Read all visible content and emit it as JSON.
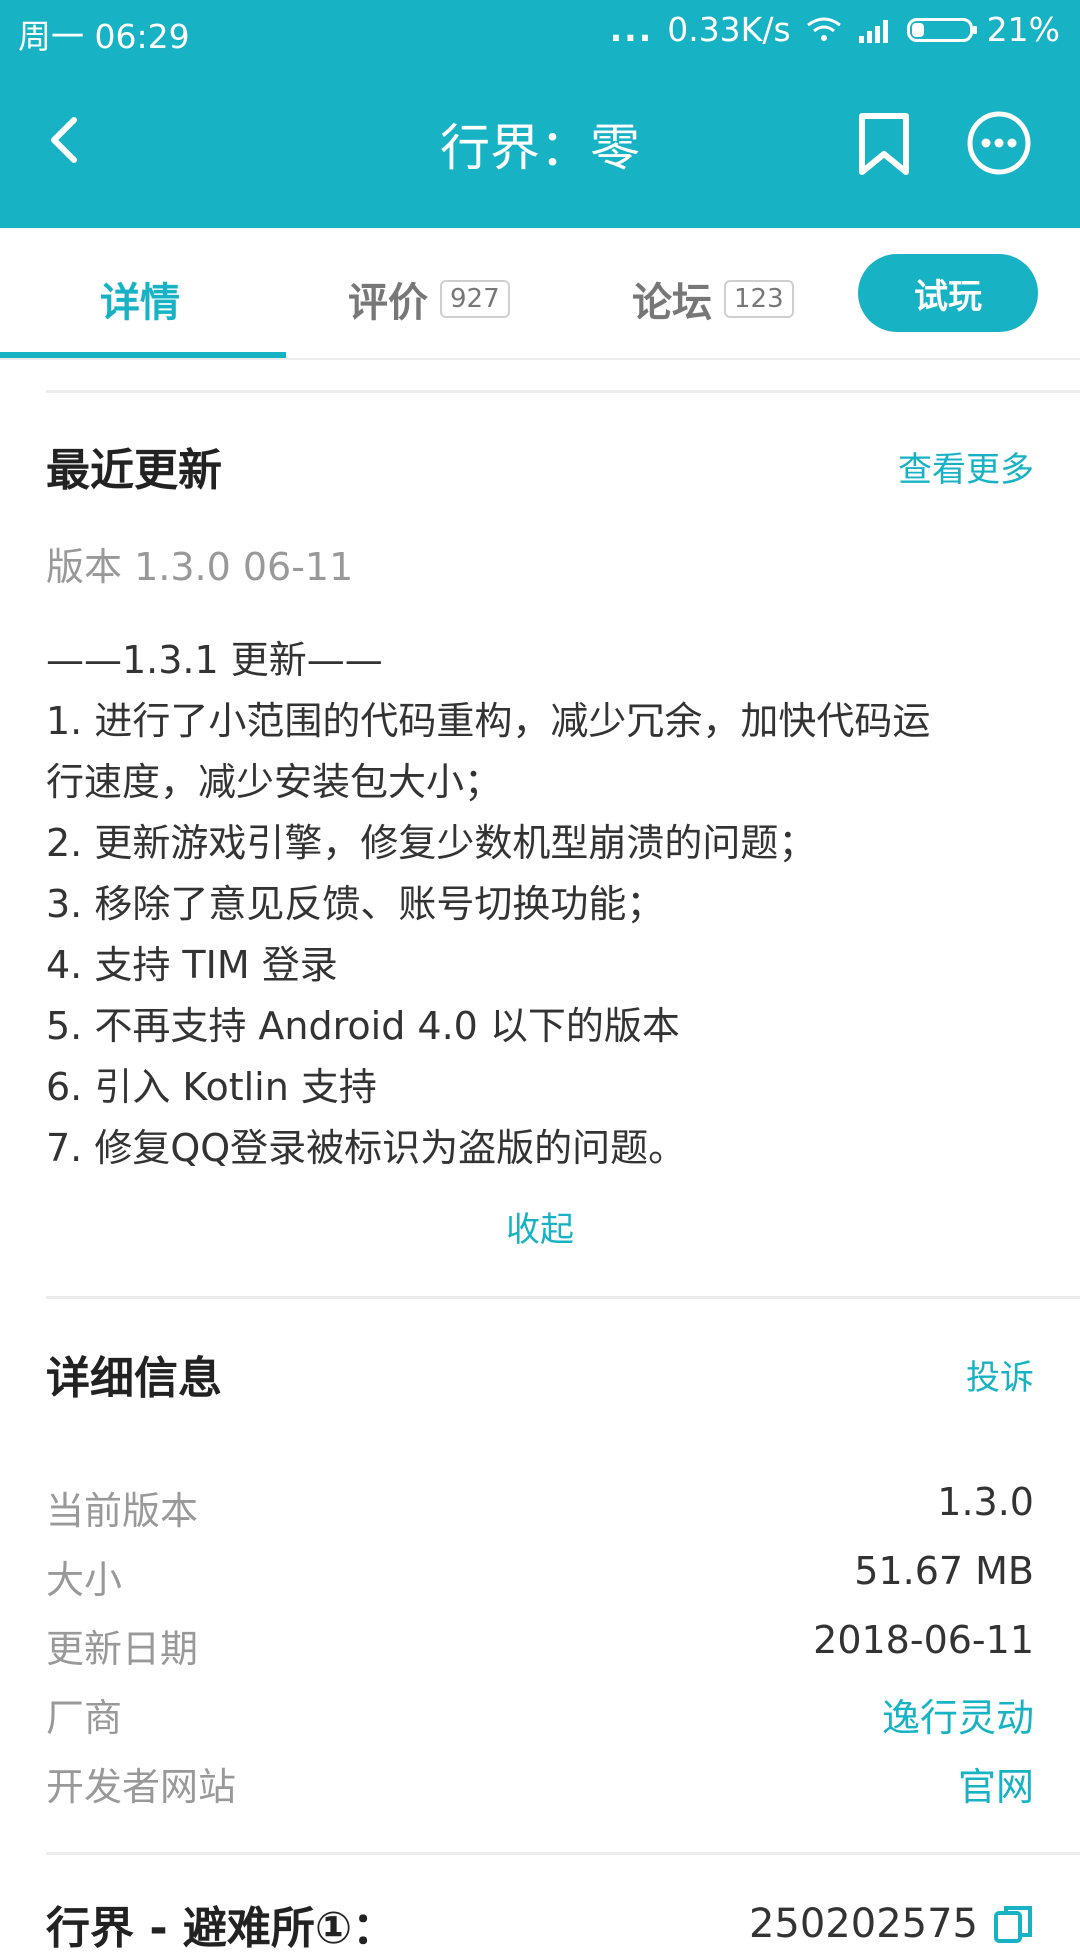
{
  "status_bar": {
    "day_time": "周一 06:29",
    "signal_dots": "...",
    "net_speed": "0.33K/s",
    "battery": "21%"
  },
  "app_bar": {
    "title": "行界：零",
    "back_icon": "chevron-left-icon",
    "bookmark_icon": "bookmark-icon",
    "more_icon": "more-circle-icon"
  },
  "tabs": [
    {
      "label": "详情",
      "count": null,
      "active": true
    },
    {
      "label": "评价",
      "count": "927",
      "active": false
    },
    {
      "label": "论坛",
      "count": "123",
      "active": false
    }
  ],
  "try_button": "试玩",
  "recent_update": {
    "title": "最近更新",
    "more_link": "查看更多",
    "version_line": "版本 1.3.0   06-11",
    "notes": [
      "——1.3.1 更新——",
      "1. 进行了小范围的代码重构，减少冗余，加快代码运",
      "行速度，减少安装包大小；",
      "2. 更新游戏引擎，修复少数机型崩溃的问题；",
      "3. 移除了意见反馈、账号切换功能；",
      "4. 支持 TIM 登录",
      "5. 不再支持 Android 4.0 以下的版本",
      "6. 引入 Kotlin 支持",
      "7. 修复QQ登录被标识为盗版的问题。"
    ],
    "collapse_label": "收起"
  },
  "details": {
    "title": "详细信息",
    "report_link": "投诉",
    "rows": [
      {
        "key": "当前版本",
        "value": "1.3.0"
      },
      {
        "key": "大小",
        "value": "51.67 MB"
      },
      {
        "key": "更新日期",
        "value": "2018-06-11"
      },
      {
        "key": "厂商",
        "value": "逸行灵动"
      },
      {
        "key": "开发者网站",
        "value": "官网"
      }
    ]
  },
  "bottom_row": {
    "label": "行界 - 避难所①：",
    "number": "250202575"
  },
  "colors": {
    "accent": "#17b3c4",
    "muted_text": "#999999",
    "body_text": "#333333"
  }
}
